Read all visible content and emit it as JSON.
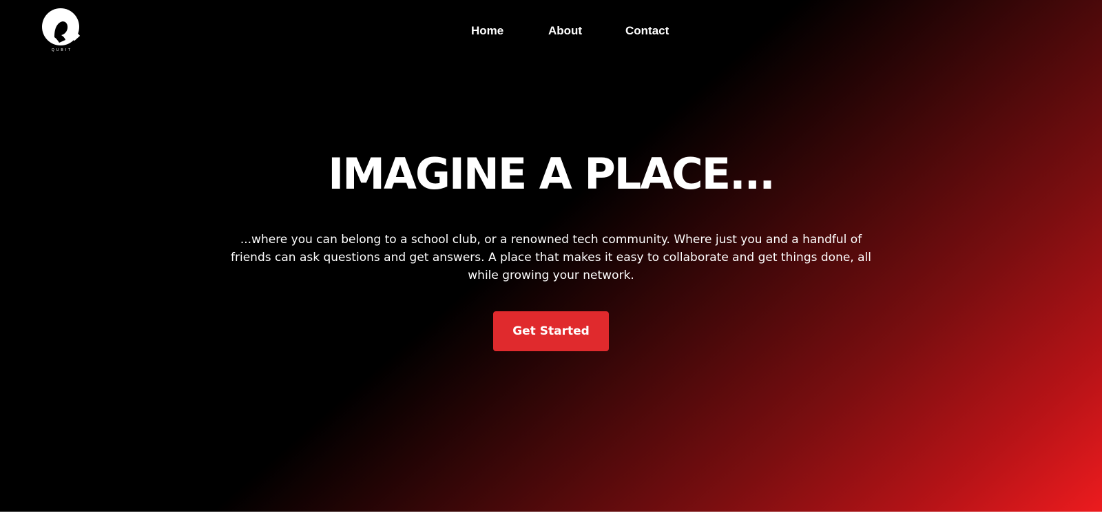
{
  "brand": {
    "logo_icon": "q-logo-icon",
    "logo_text": "QUBIT"
  },
  "nav": {
    "items": [
      {
        "label": "Home"
      },
      {
        "label": "About"
      },
      {
        "label": "Contact"
      }
    ]
  },
  "hero": {
    "title": "IMAGINE A PLACE...",
    "description": "...where you can belong to a school club, or a renowned tech community. Where just you and a handful of friends can ask questions and get answers. A place that makes it easy to collaborate and get things done, all while growing your network.",
    "cta_label": "Get Started"
  },
  "colors": {
    "background_dark": "#000000",
    "gradient_red": "#f01c1f",
    "cta_background": "#e02a2d",
    "text": "#ffffff"
  }
}
